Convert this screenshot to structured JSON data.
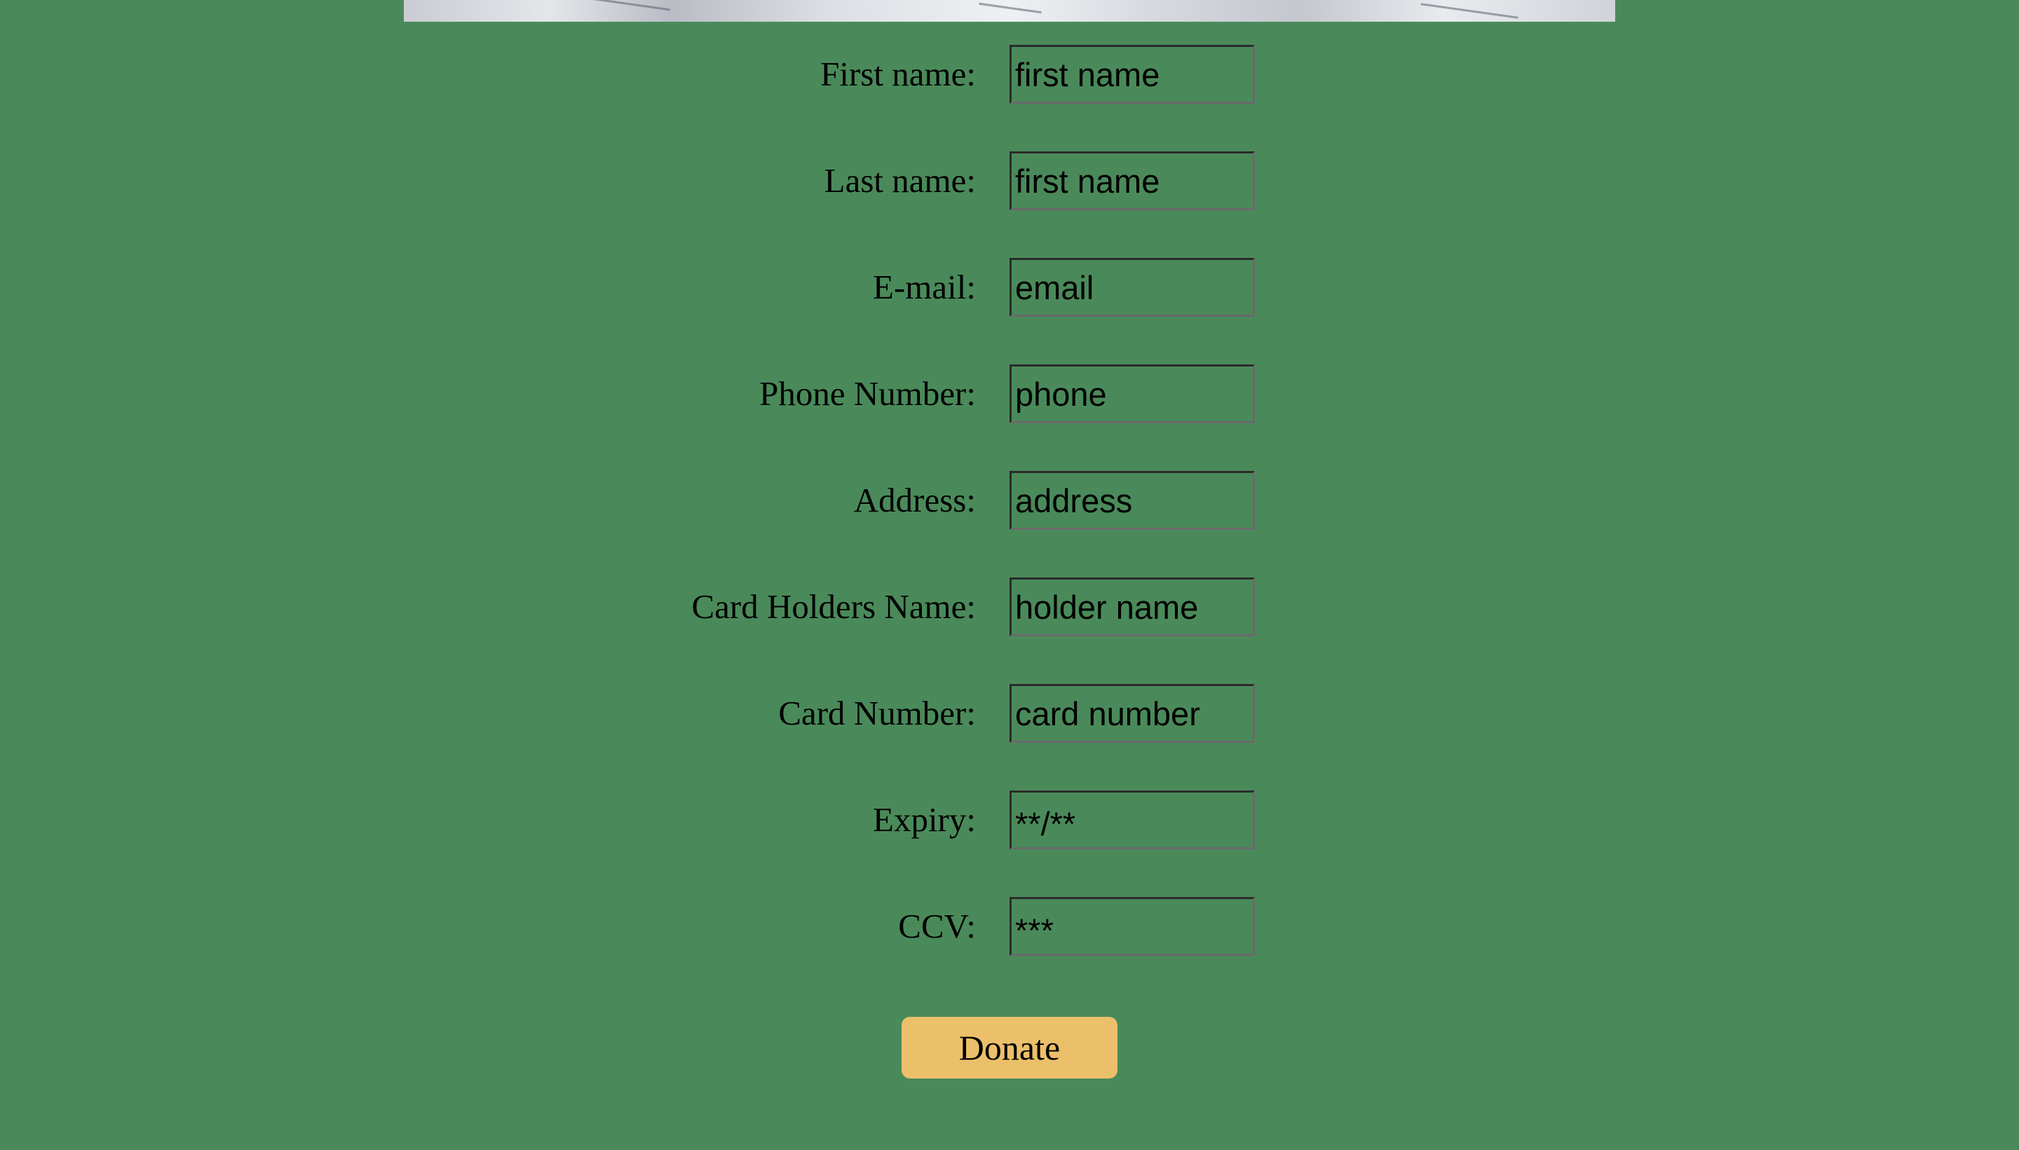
{
  "form": {
    "fields": [
      {
        "label": "First name:",
        "placeholder": "first name"
      },
      {
        "label": "Last name:",
        "placeholder": "first name"
      },
      {
        "label": "E-mail:",
        "placeholder": "email"
      },
      {
        "label": "Phone Number:",
        "placeholder": "phone"
      },
      {
        "label": "Address:",
        "placeholder": "address"
      },
      {
        "label": "Card Holders Name:",
        "placeholder": "holder name"
      },
      {
        "label": "Card Number:",
        "placeholder": "card number"
      },
      {
        "label": "Expiry:",
        "placeholder": "**/**"
      },
      {
        "label": "CCV:",
        "placeholder": "***"
      }
    ],
    "submit_label": "Donate"
  },
  "colors": {
    "background": "#4a8a5a",
    "button": "#ecc06a",
    "text": "#000000"
  }
}
